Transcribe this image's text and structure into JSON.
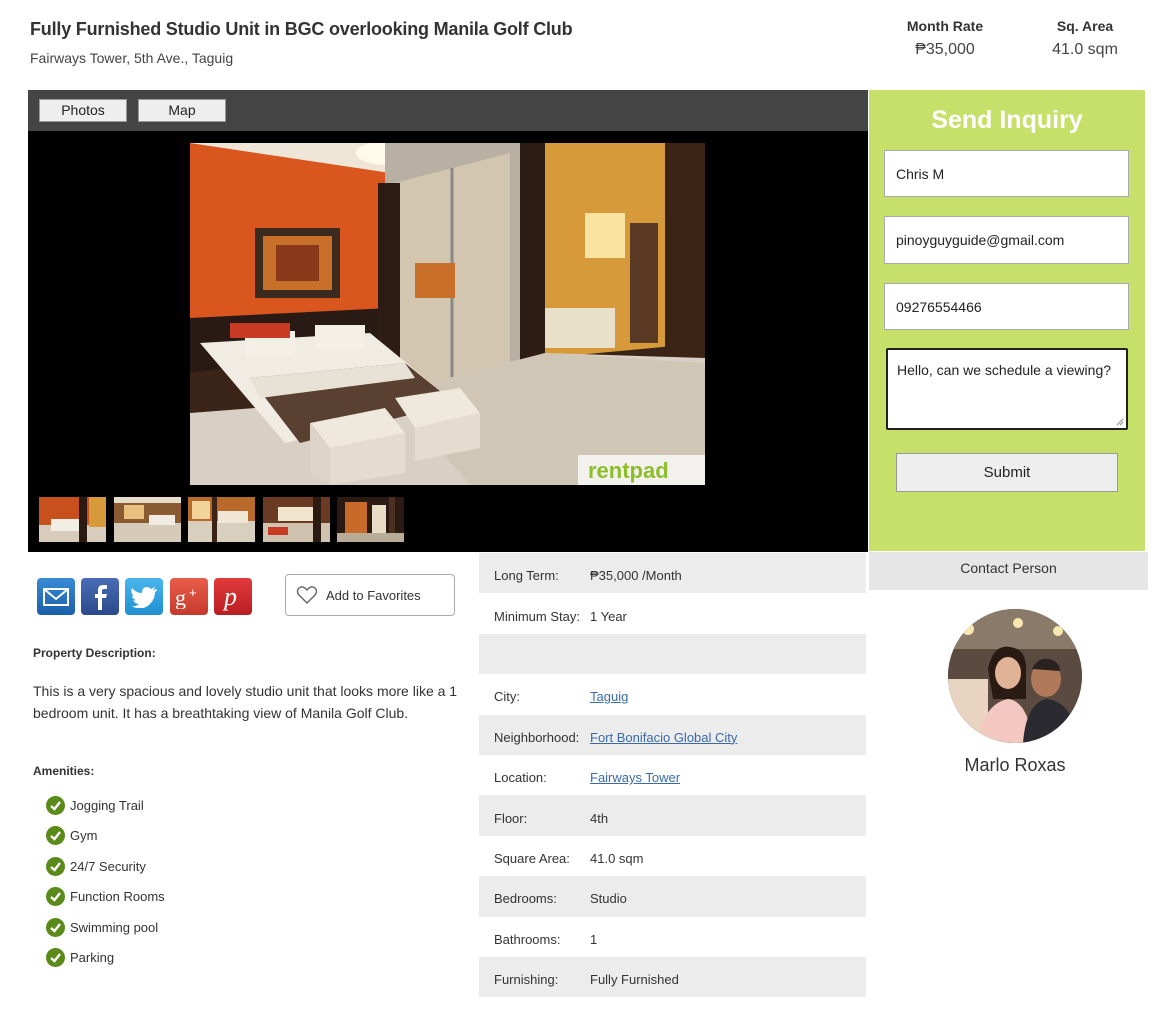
{
  "listing": {
    "title": "Fully Furnished Studio Unit in BGC overlooking Manila Golf Club",
    "address": "Fairways Tower, 5th Ave., Taguig",
    "month_rate_label": "Month Rate",
    "month_rate": "₱35,000",
    "sq_area_label": "Sq. Area",
    "sq_area": "41.0 sqm"
  },
  "gallery": {
    "tabs": [
      "Photos",
      "Map"
    ],
    "watermark": "rentpad",
    "thumbnail_count": 5
  },
  "inquiry": {
    "title": "Send Inquiry",
    "name": "Chris M",
    "email": "pinoyguyguide@gmail.com",
    "phone": "09276554466",
    "message": "Hello, can we schedule a viewing?",
    "submit": "Submit"
  },
  "contact": {
    "header": "Contact Person",
    "name": "Marlo Roxas"
  },
  "share": {
    "icons": [
      "email-icon",
      "facebook-icon",
      "twitter-icon",
      "google-plus-icon",
      "pinterest-icon"
    ],
    "favorites_label": "Add to Favorites"
  },
  "description": {
    "label": "Property Description:",
    "text": "This is a very spacious and lovely studio unit that looks more like a 1 bedroom unit. It has a breathtaking view of Manila Golf Club."
  },
  "amenities": {
    "label": "Amenities:",
    "items": [
      "Jogging Trail",
      "Gym",
      "24/7 Security",
      "Function Rooms",
      "Swimming pool",
      "Parking"
    ]
  },
  "details": [
    {
      "key": "Long Term:",
      "value": "₱35,000 /Month",
      "link": false
    },
    {
      "key": "Minimum Stay:",
      "value": "1 Year",
      "link": false
    },
    {
      "key": "",
      "value": "",
      "link": false
    },
    {
      "key": "City:",
      "value": "Taguig",
      "link": true
    },
    {
      "key": "Neighborhood:",
      "value": "Fort Bonifacio Global City",
      "link": true
    },
    {
      "key": "Location:",
      "value": "Fairways Tower",
      "link": true
    },
    {
      "key": "Floor:",
      "value": "4th",
      "link": false
    },
    {
      "key": "Square Area:",
      "value": "41.0 sqm",
      "link": false
    },
    {
      "key": "Bedrooms:",
      "value": "Studio",
      "link": false
    },
    {
      "key": "Bathrooms:",
      "value": "1",
      "link": false
    },
    {
      "key": "Furnishing:",
      "value": "Fully Furnished",
      "link": false
    }
  ],
  "colors": {
    "inquiry_bg": "#c6e06a",
    "check_green": "#5a8a1a",
    "link_blue": "#3a6aaa"
  }
}
